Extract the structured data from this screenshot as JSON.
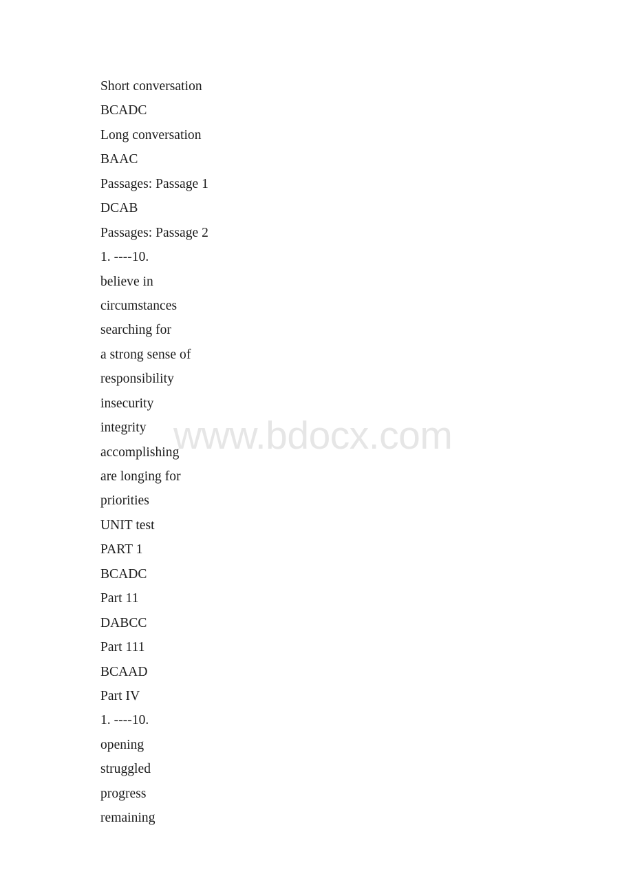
{
  "document": {
    "page_background": "#ffffff",
    "text_color": "#1b1b1b",
    "watermark": {
      "text": "www.bdocx.com",
      "color": "#e6e6e6"
    },
    "lines": [
      "Short conversation",
      "BCADC",
      "Long conversation",
      "BAAC",
      "Passages: Passage 1",
      "DCAB",
      "Passages: Passage 2",
      "1. ----10.",
      "believe in",
      "circumstances",
      "searching for",
      "a strong sense of",
      "responsibility",
      "insecurity",
      "integrity",
      "accomplishing",
      "are longing for",
      "priorities",
      "UNIT test",
      "PART 1",
      "BCADC",
      "Part 11",
      "DABCC",
      "Part 111",
      "BCAAD",
      "Part IV",
      "1. ----10.",
      "opening",
      "struggled",
      "progress",
      "remaining"
    ]
  }
}
